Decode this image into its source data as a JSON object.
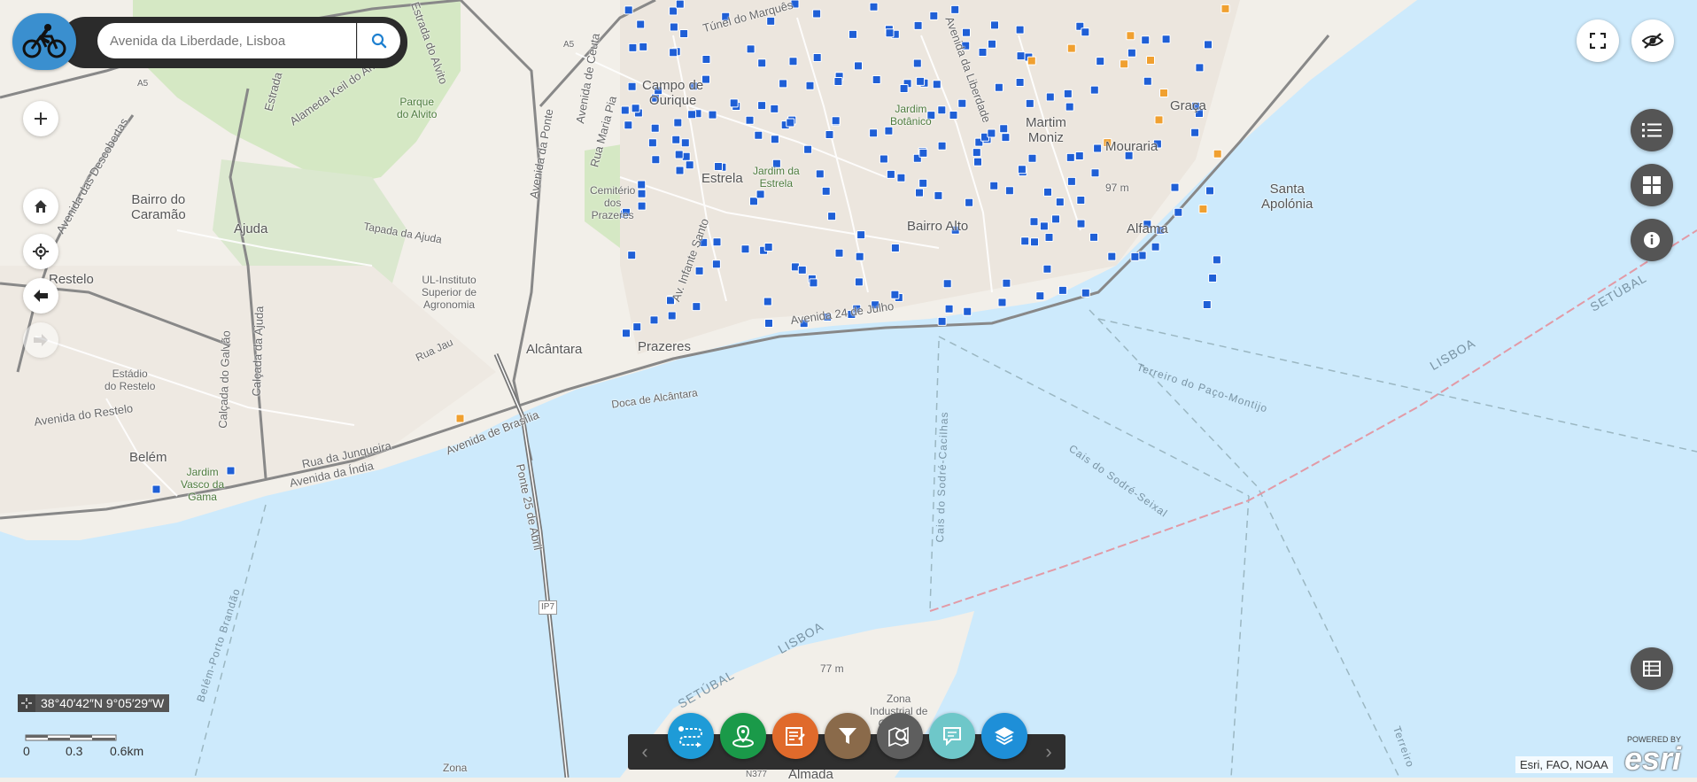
{
  "search": {
    "placeholder": "Avenida da Liberdade, Lisboa"
  },
  "coordinates": "38°40′42″N 9°05′29″W",
  "scale": {
    "labels": [
      "0",
      "0.3",
      "0.6km"
    ]
  },
  "attribution": "Esri, FAO, NOAA",
  "esri": {
    "powered": "POWERED BY",
    "word": "esri"
  },
  "map_labels": {
    "campo_de_ourique": "Campo de\nOurique",
    "parque_do_alvito": "Parque\ndo Alvito",
    "bairro_do_caramao": "Bairro do\nCaramão",
    "ajuda": "Ajuda",
    "restelo": "Restelo",
    "estrela": "Estrela",
    "cemiterio": "Cemitério\ndos\nPrazeres",
    "jardim_estrela": "Jardim da\nEstrela",
    "jardim_botanico": "Jardim\nBotânico",
    "martim_moniz": "Martim\nMoniz",
    "mouraria": "Mouraria",
    "graca": "Graça",
    "santa_apolonia": "Santa\nApolónia",
    "bairro_alto": "Bairro Alto",
    "alfama": "Alfama",
    "ul_instituto": "UL-Instituto\nSuperior de\nAgronomia",
    "alcantara": "Alcântara",
    "prazeres": "Prazeres",
    "estadio": "Estádio\ndo Restelo",
    "belem": "Belém",
    "jardim_vasco": "Jardim\nVasco da\nGama",
    "doca": "Doca de Alcântara",
    "tapada": "Tapada da Ajuda",
    "rua_jau": "Rua Jau",
    "zona_industrial": "Zona\nIndustrial de\nCacilhas",
    "almada": "Almada",
    "zona": "Zona",
    "elev_97": "97 m",
    "elev_77": "77 m",
    "a5_1": "A5",
    "a5_2": "A5",
    "ip7": "IP7",
    "n377": "N377"
  },
  "road_labels": {
    "tunel": "Túnel do Marquês",
    "estrada_alvito": "Estrada do Alvito",
    "alameda": "Alameda Keil do Amaral",
    "estrada_2": "Estrada",
    "av_descobertas": "Avenida das Descobertas",
    "av_ponte": "Avenida da Ponte",
    "av_ceuta": "Avenida de Ceuta",
    "rua_maria_pia": "Rua Maria Pia",
    "av_24_julho": "Avenida 24 de Julho",
    "rua_junqueira": "Rua da Junqueira",
    "av_india": "Avenida da Índia",
    "av_brasilia": "Avenida de Brasília",
    "ponte_25": "Ponte 25 de Abril",
    "calcada_ajuda": "Calçada da Ajuda",
    "calcada_galvao": "Calçada do Galvão",
    "av_restelo": "Avenida do Restelo",
    "av_infante": "Av. Infante Santo",
    "av_liberdade": "Avenida da Liberdade"
  },
  "water_labels": {
    "terreiro": "Terreiro do Paço-Montijo",
    "cais_sodre_cacilhas": "Cais do Sodré-Cacilhas",
    "cais_sodre_seixal": "Cais do Sodré-Seixal",
    "belem_porto": "Belém-Porto Brandão",
    "lisboa_1": "LISBOA",
    "lisboa_2": "LISBOA",
    "setubal_1": "SETÚBAL",
    "setubal_2": "SETÚBAL",
    "terreiro_2": "Terreiro"
  },
  "icons": {
    "logo": "cyclist-icon",
    "search": "search-icon",
    "zoom_in": "plus-icon",
    "home": "home-icon",
    "locate": "locate-icon",
    "back": "arrow-left-icon",
    "forward": "arrow-right-icon",
    "fullscreen": "fullscreen-icon",
    "toggle_visibility": "eye-slash-icon",
    "legend": "list-icon",
    "basemap": "grid-icon",
    "info": "info-icon",
    "table": "table-icon"
  },
  "toolbar": {
    "prev": "‹",
    "next": "›",
    "tools": [
      {
        "name": "directions-tool",
        "color": "#1e9bd7"
      },
      {
        "name": "location-tool",
        "color": "#1a9a49"
      },
      {
        "name": "report-tool",
        "color": "#e06a2b"
      },
      {
        "name": "filter-tool",
        "color": "#8a6a4a"
      },
      {
        "name": "search-map-tool",
        "color": "#5e5e5e"
      },
      {
        "name": "comment-tool",
        "color": "#6ec7c9"
      },
      {
        "name": "layers-tool",
        "color": "#1e8fd8"
      }
    ]
  },
  "colors": {
    "water": "#cdeafc",
    "land": "#f2efe9",
    "park": "#d5e8c4",
    "marker_blue": "#1f5fd6",
    "marker_orange": "#f0a030",
    "ferry_line": "#9bb7c2",
    "border_line": "#e29aa6"
  }
}
